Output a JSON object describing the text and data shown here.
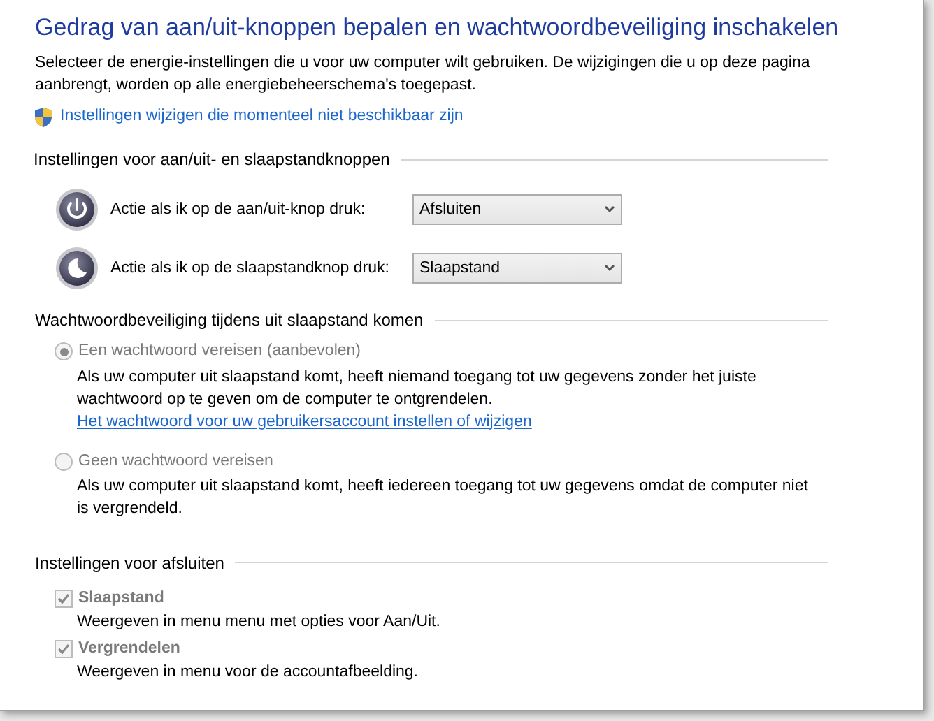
{
  "title": "Gedrag van aan/uit-knoppen bepalen en wachtwoordbeveiliging inschakelen",
  "description": "Selecteer de energie-instellingen die u voor uw computer wilt gebruiken. De wijzigingen die u op deze pagina aanbrengt, worden op alle energiebeheerschema's toegepast.",
  "admin_link": "Instellingen wijzigen die momenteel niet beschikbaar zijn",
  "power_section": {
    "heading": "Instellingen voor aan/uit- en slaapstandknoppen",
    "rows": [
      {
        "kind": "power",
        "label": "Actie als ik op de aan/uit-knop druk:",
        "value": "Afsluiten"
      },
      {
        "kind": "sleep",
        "label": "Actie als ik op de slaapstandknop druk:",
        "value": "Slaapstand"
      }
    ]
  },
  "password_section": {
    "heading": "Wachtwoordbeveiliging tijdens uit slaapstand komen",
    "options": [
      {
        "label": "Een wachtwoord vereisen (aanbevolen)",
        "selected": true,
        "disabled": true,
        "description": "Als uw computer uit slaapstand komt, heeft niemand toegang tot uw gegevens zonder het juiste wachtwoord op te geven om de computer te ontgrendelen.",
        "link": "Het wachtwoord voor uw gebruikersaccount instellen of wijzigen"
      },
      {
        "label": "Geen wachtwoord vereisen",
        "selected": false,
        "disabled": true,
        "description": "Als uw computer uit slaapstand komt, heeft iedereen toegang tot uw gegevens omdat de computer niet is vergrendeld."
      }
    ]
  },
  "shutdown_section": {
    "heading": "Instellingen voor afsluiten",
    "options": [
      {
        "label": "Slaapstand",
        "checked": true,
        "disabled": true,
        "description": "Weergeven in menu menu met opties voor Aan/Uit."
      },
      {
        "label": "Vergrendelen",
        "checked": true,
        "disabled": true,
        "description": "Weergeven in menu voor de accountafbeelding."
      }
    ]
  }
}
